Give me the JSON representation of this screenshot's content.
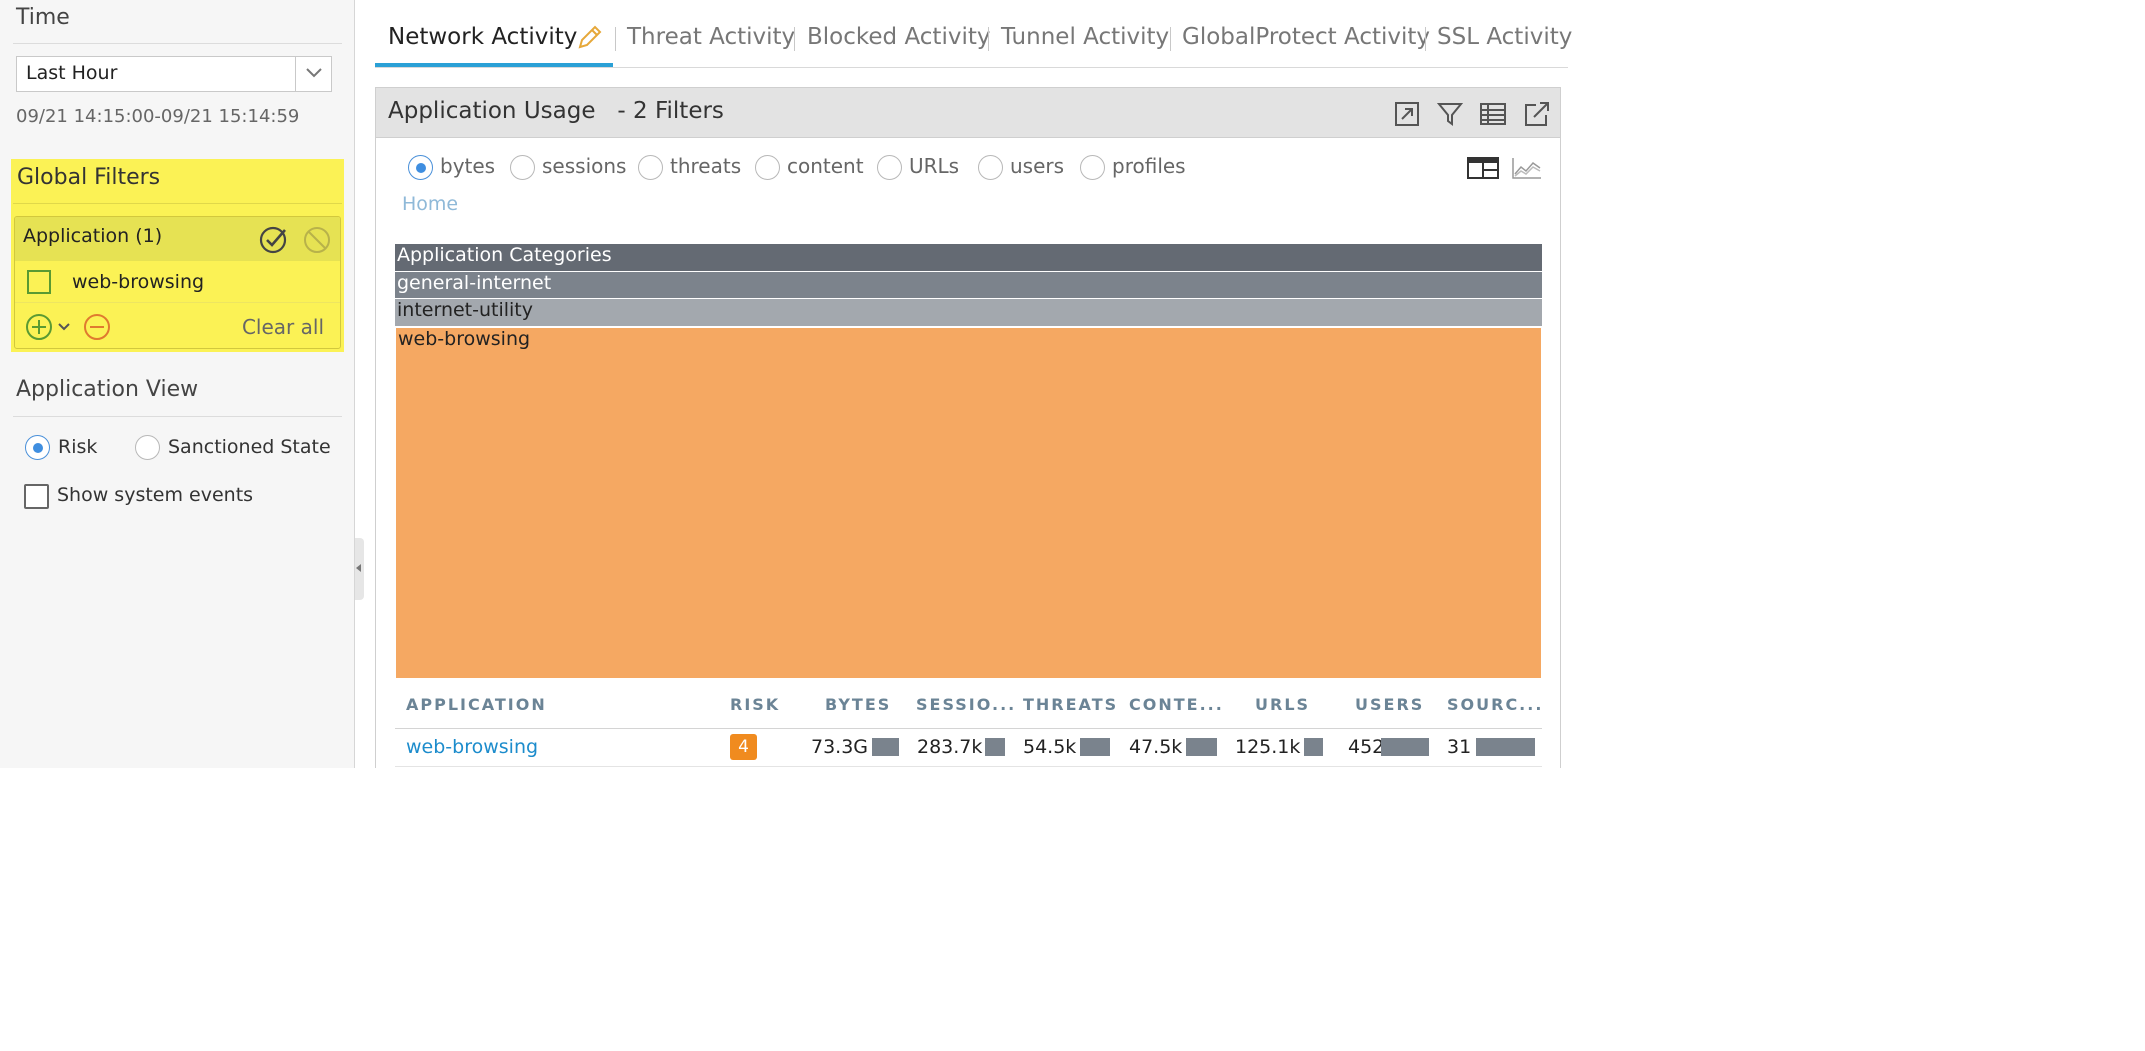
{
  "sidebar": {
    "time_title": "Time",
    "time_select_value": "Last Hour",
    "time_range": "09/21 14:15:00-09/21 15:14:59",
    "global_filters": {
      "title": "Global Filters",
      "group_label": "Application (1)",
      "items": [
        {
          "label": "web-browsing"
        }
      ],
      "clear_all": "Clear all",
      "highlight_color": "#fbf255"
    },
    "app_view": {
      "title": "Application View",
      "options": [
        {
          "label": "Risk",
          "selected": true
        },
        {
          "label": "Sanctioned State",
          "selected": false
        }
      ],
      "show_system_events": "Show system events"
    }
  },
  "tabs": [
    {
      "label": "Network Activity",
      "active": true
    },
    {
      "label": "Threat Activity"
    },
    {
      "label": "Blocked Activity"
    },
    {
      "label": "Tunnel Activity"
    },
    {
      "label": "GlobalProtect Activity"
    },
    {
      "label": "SSL Activity"
    }
  ],
  "widget": {
    "title": "Application Usage   - 2 Filters",
    "metrics": [
      {
        "label": "bytes",
        "selected": true
      },
      {
        "label": "sessions"
      },
      {
        "label": "threats"
      },
      {
        "label": "content"
      },
      {
        "label": "URLs"
      },
      {
        "label": "users"
      },
      {
        "label": "profiles"
      }
    ],
    "breadcrumb": "Home",
    "treemap": {
      "header": "Application Categories",
      "bands": [
        "general-internet",
        "internet-utility",
        "web-browsing"
      ],
      "colors": {
        "header": "#646a73",
        "general-internet": "#7c838c",
        "internet-utility": "#a3a8ae",
        "web-browsing": "#f5a862"
      }
    },
    "table": {
      "columns": [
        "APPLICATION",
        "RISK",
        "BYTES",
        "SESSIO...",
        "THREATS",
        "CONTE...",
        "URLS",
        "USERS",
        "SOURC..."
      ],
      "rows": [
        {
          "application": "web-browsing",
          "risk": "4",
          "bytes": "73.3G",
          "sessions": "283.7k",
          "threats": "54.5k",
          "content": "47.5k",
          "urls": "125.1k",
          "users": "452",
          "sources": "31"
        }
      ]
    }
  }
}
